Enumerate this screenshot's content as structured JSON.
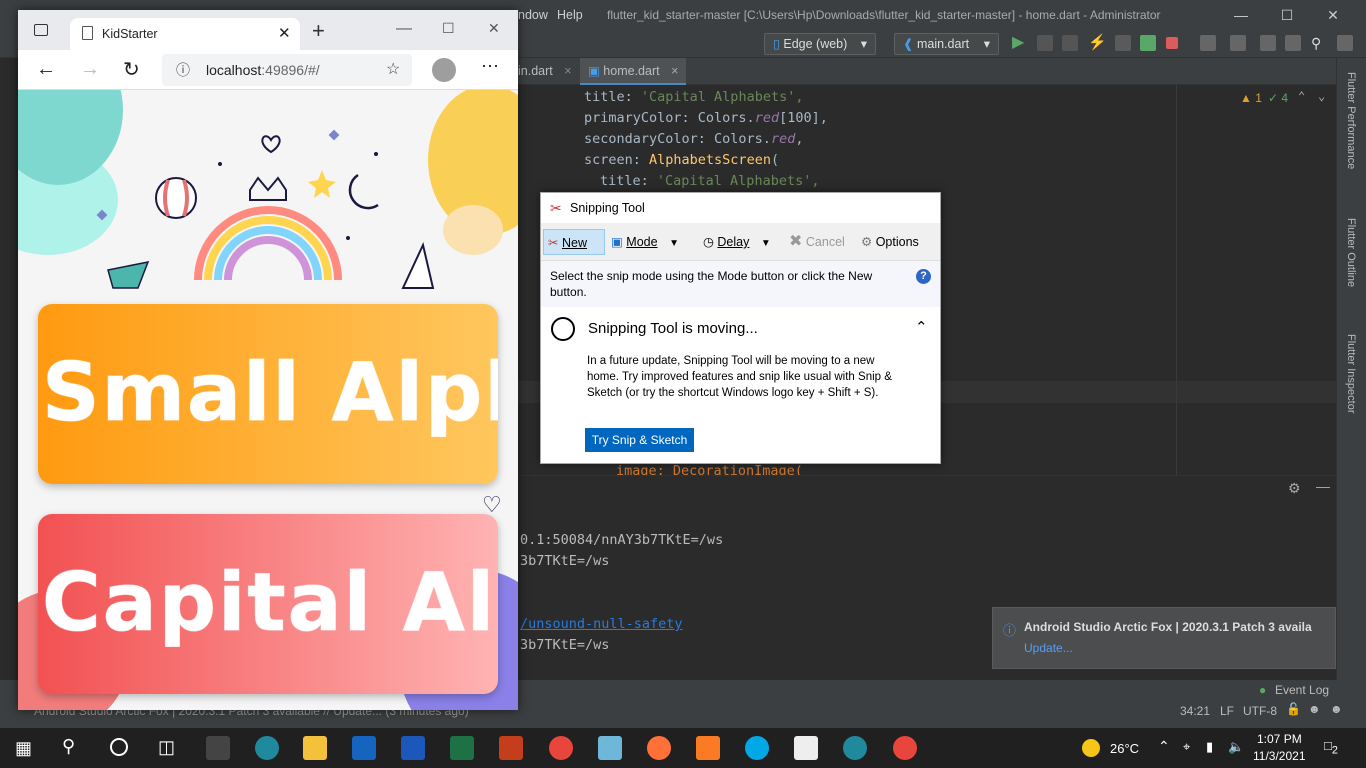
{
  "ide": {
    "menu_window": "ndow",
    "menu_help": "Help",
    "title": "flutter_kid_starter-master [C:\\Users\\Hp\\Downloads\\flutter_kid_starter-master] - home.dart - Administrator",
    "device_combo": "Edge (web)",
    "run_config": "main.dart",
    "tabs": [
      {
        "label": "in.dart"
      },
      {
        "label": "home.dart"
      }
    ],
    "inspections": {
      "warnings": "1",
      "weak": "4"
    },
    "code": {
      "l1_key": "title: ",
      "l1_str": "'Capital Alphabets',",
      "l2_key": "primaryColor: Colors.",
      "l2_red": "red",
      "l2_num": "[100],",
      "l3_key": "secondaryColor: Colors.",
      "l3_red": "red",
      "l3_end": ",",
      "l4_key": "screen: ",
      "l4_cls": "AlphabetsScreen",
      "l4_end": "(",
      "l5_key": "title: ",
      "l5_str": "'Capital Alphabets',",
      "l6": "image: DecorationImage("
    },
    "right_tabs": [
      "Flutter Performance",
      "Flutter Outline",
      "Flutter Inspector"
    ],
    "run_output": {
      "l1": "0.1:50084/nnAY3b7TKtE=/ws",
      "l2": "3b7TKtE=/ws",
      "l3": "/unsound-null-safety",
      "l4": "3b7TKtE=/ws"
    },
    "notification": {
      "title": "Android Studio Arctic Fox | 2020.3.1 Patch 3 availa",
      "link": "Update..."
    },
    "event_log": "Event Log",
    "status": {
      "left": "Android Studio Arctic Fox | 2020.3.1 Patch 3 available // Update... (3 minutes ago)",
      "position": "34:21",
      "line_sep": "LF",
      "encoding": "UTF-8"
    }
  },
  "browser": {
    "tab_title": "KidStarter",
    "url_host": "localhost",
    "url_rest": ":49896/#/",
    "cards": [
      {
        "label": "Small Alph"
      },
      {
        "label": "Capital Alp"
      }
    ]
  },
  "snipping": {
    "title": "Snipping Tool",
    "new": "New",
    "mode": "Mode",
    "delay": "Delay",
    "cancel": "Cancel",
    "options": "Options",
    "info": "Select the snip mode using the Mode button or click the New button.",
    "moving_title": "Snipping Tool is moving...",
    "moving_body": "In a future update, Snipping Tool will be moving to a new home. Try improved features and snip like usual with Snip & Sketch (or try the shortcut Windows logo key + Shift + S).",
    "try_button": "Try Snip & Sketch"
  },
  "taskbar": {
    "temperature": "26°C",
    "time": "1:07 PM",
    "date": "11/3/2021",
    "notifications": "2"
  }
}
